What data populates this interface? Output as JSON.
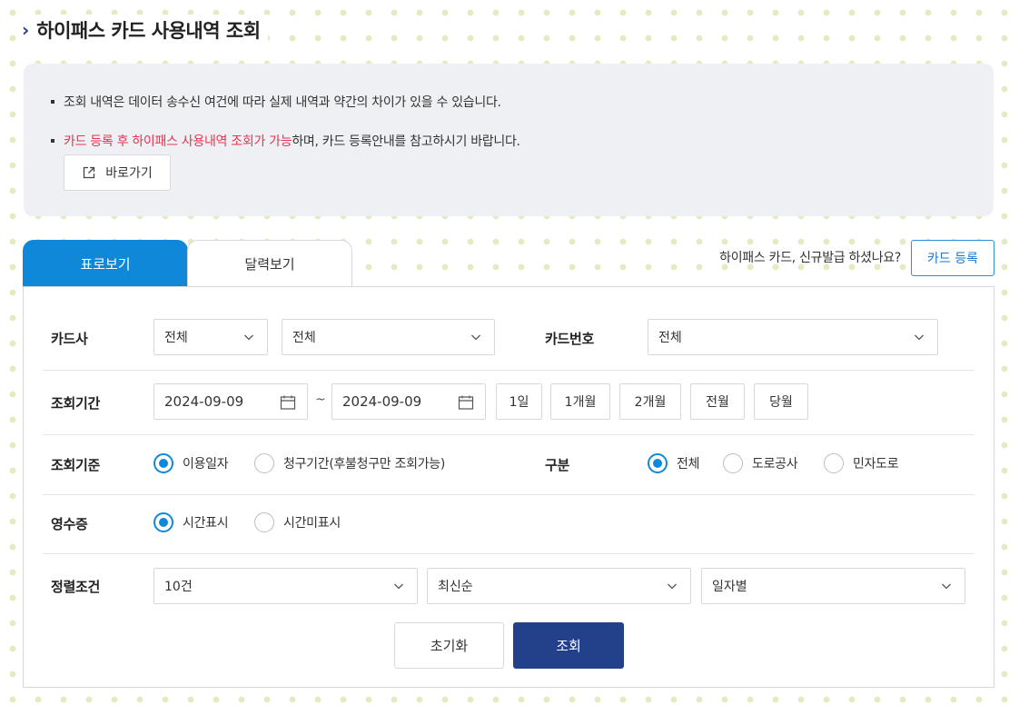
{
  "page": {
    "title": "하이패스 카드 사용내역 조회"
  },
  "notice": {
    "line1": "조회 내역은 데이터 송수신 여건에 따라 실제 내역과 약간의 차이가 있을 수 있습니다.",
    "line2_highlight": "카드 등록 후 하이패스 사용내역 조회가 가능",
    "line2_rest": "하며, 카드 등록안내를 참고하시기 바랍니다.",
    "go_button": "바로가기"
  },
  "tabs": [
    {
      "label": "표로보기",
      "active": true
    },
    {
      "label": "달력보기",
      "active": false
    }
  ],
  "issue": {
    "question": "하이패스 카드, 신규발급 하셨나요?",
    "register_button": "카드 등록"
  },
  "form": {
    "card_company": {
      "label": "카드사",
      "select1": "전체",
      "select2": "전체"
    },
    "card_number": {
      "label": "카드번호",
      "select": "전체"
    },
    "period": {
      "label": "조회기간",
      "start": "2024-09-09",
      "separator": "~",
      "end": "2024-09-09",
      "quick_buttons": [
        "1일",
        "1개월",
        "2개월",
        "전월",
        "당월"
      ]
    },
    "basis": {
      "label": "조회기준",
      "options": [
        "이용일자",
        "청구기간(후불청구만 조회가능)"
      ],
      "selected": "이용일자"
    },
    "category": {
      "label": "구분",
      "options": [
        "전체",
        "도로공사",
        "민자도로"
      ],
      "selected": "전체"
    },
    "receipt": {
      "label": "영수증",
      "options": [
        "시간표시",
        "시간미표시"
      ],
      "selected": "시간표시"
    },
    "sort": {
      "label": "정렬조건",
      "count": "10건",
      "order": "최신순",
      "group": "일자별"
    }
  },
  "actions": {
    "reset": "초기화",
    "search": "조회"
  },
  "colors": {
    "accent_blue": "#0f88d9",
    "navy_button": "#23418a",
    "highlight_red": "#e53551",
    "notice_bg": "#eef0f3"
  }
}
